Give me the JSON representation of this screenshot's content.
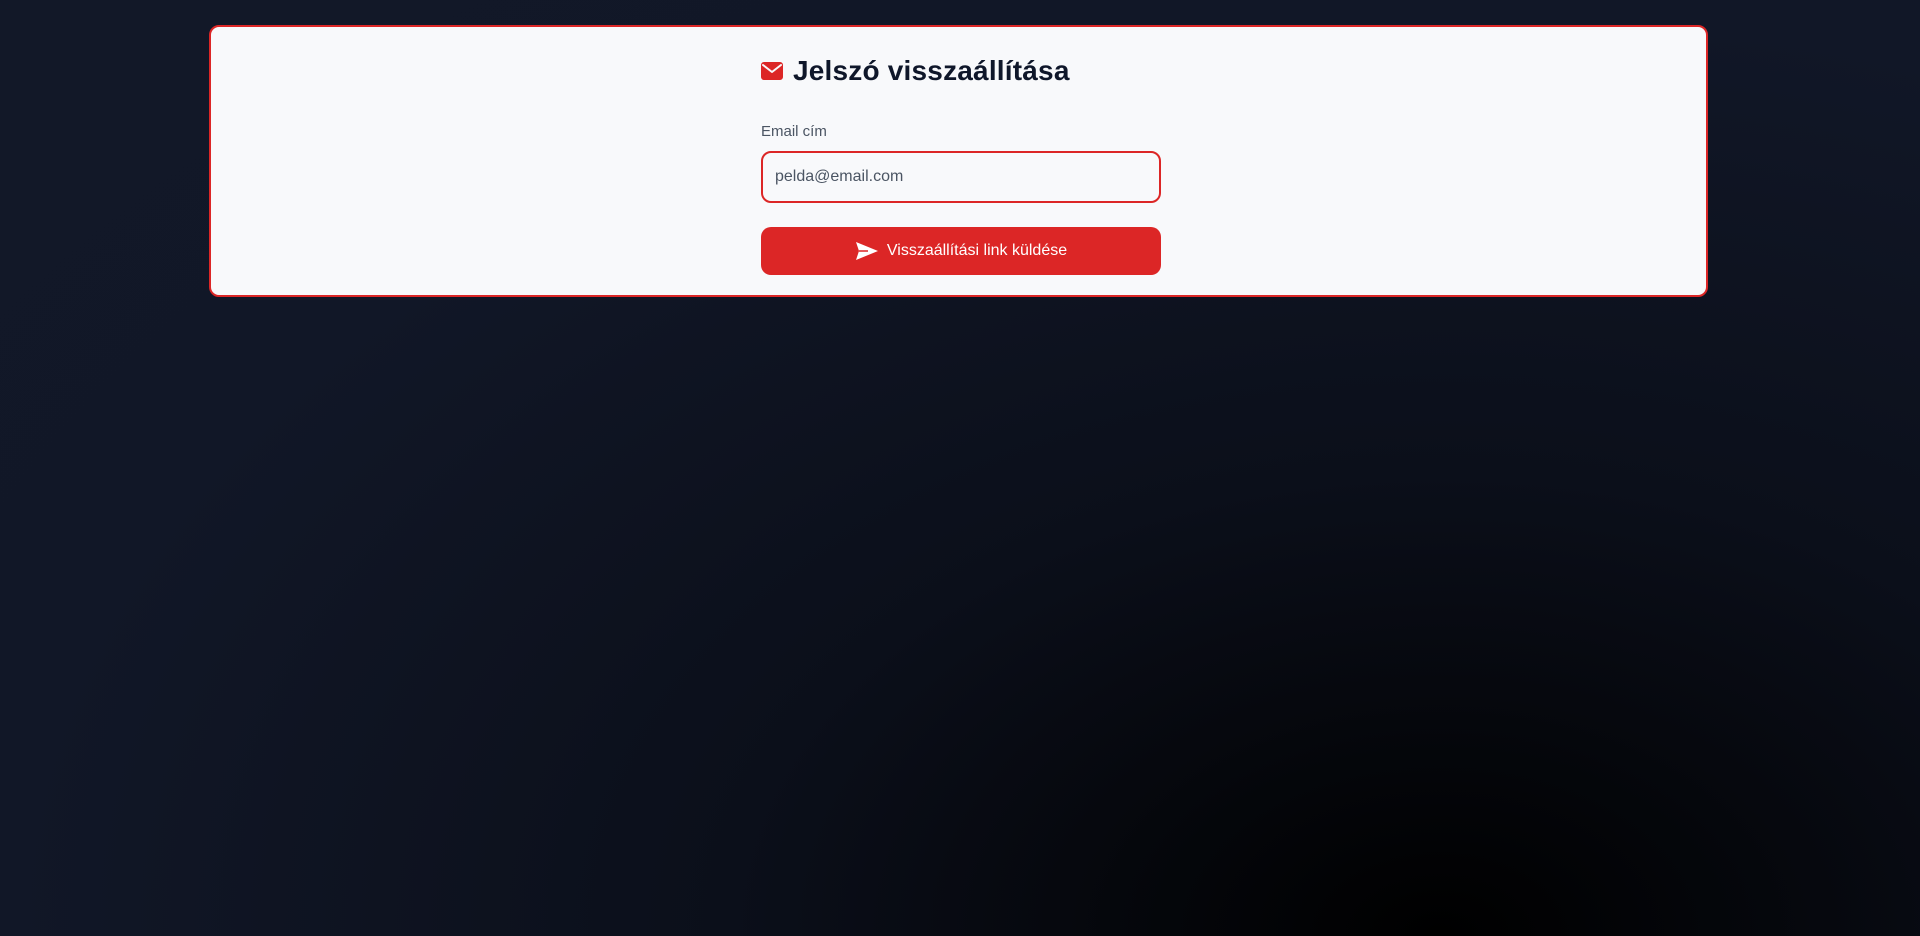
{
  "form": {
    "title": "Jelszó visszaállítása",
    "title_icon": "envelope-icon",
    "email_label": "Email cím",
    "email_placeholder": "pelda@email.com",
    "email_value": "",
    "submit_label": "Visszaállítási link küldése",
    "submit_icon": "send-icon"
  },
  "colors": {
    "accent": "#dc2626",
    "card_background": "#f8f9fb",
    "page_background": "#111727",
    "heading_text": "#0f172a"
  }
}
